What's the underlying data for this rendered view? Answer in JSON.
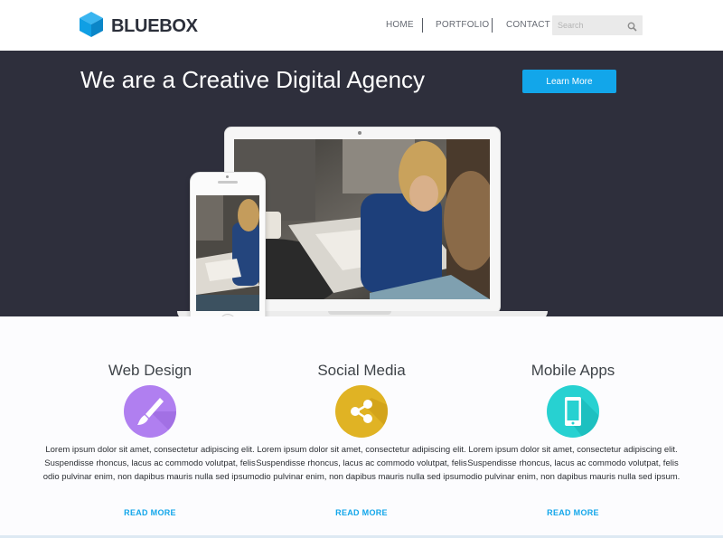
{
  "brand": {
    "name": "BLUEBOX"
  },
  "nav": {
    "items": [
      {
        "label": "HOME"
      },
      {
        "label": "PORTFOLIO"
      },
      {
        "label": "CONTACT"
      }
    ],
    "search_placeholder": "Search"
  },
  "hero": {
    "title": "We are a Creative Digital Agency",
    "cta_label": "Learn More"
  },
  "services": [
    {
      "title": "Web Design",
      "icon": "paintbrush-icon",
      "text": "Lorem ipsum dolor sit amet, consectetur adipiscing elit. Suspendisse rhoncus, lacus ac commodo volutpat, felis odio pulvinar enim, non dapibus mauris nulla sed ipsum.",
      "link": "READ MORE"
    },
    {
      "title": "Social Media",
      "icon": "share-icon",
      "text": "Lorem ipsum dolor sit amet, consectetur adipiscing elit. Suspendisse rhoncus, lacus ac commodo volutpat, felis odio pulvinar enim, non dapibus mauris nulla sed ipsum.",
      "link": "READ MORE"
    },
    {
      "title": "Mobile Apps",
      "icon": "smartphone-icon",
      "text": "Lorem ipsum dolor sit amet, consectetur adipiscing elit. Suspendisse rhoncus, lacus ac commodo volutpat, felis odio pulvinar enim, non dapibus mauris nulla sed ipsum.",
      "link": "READ MORE"
    }
  ],
  "colors": {
    "accent": "#12a6ea",
    "hero_bg": "#2e2f3c",
    "web_design_icon": "#b07ff0",
    "social_media_icon": "#e0b324",
    "mobile_apps_icon": "#27d1d1"
  }
}
